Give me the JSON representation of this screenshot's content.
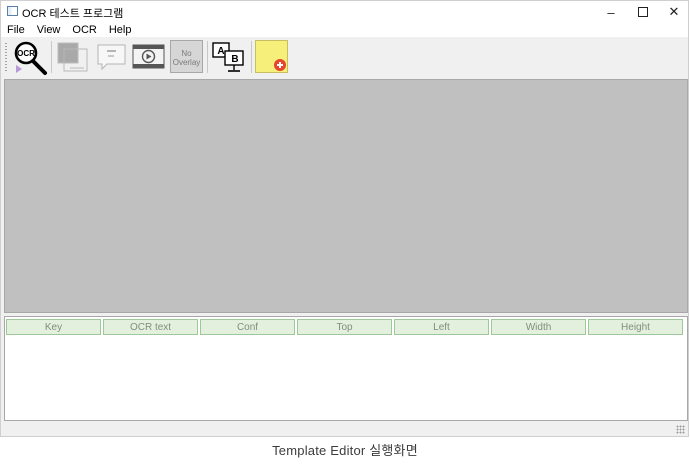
{
  "window": {
    "title": "OCR 테스트 프로그램",
    "controls": {
      "minimize": "–",
      "close": "✕"
    }
  },
  "menu": [
    "File",
    "View",
    "OCR",
    "Help"
  ],
  "toolbar": {
    "ocr_icon_text": "OCR",
    "no_overlay_line1": "No",
    "no_overlay_line2": "Overlay",
    "ab_icon_a": "A",
    "ab_icon_b": "B"
  },
  "grid": {
    "columns": [
      "Key",
      "OCR text",
      "Conf",
      "Top",
      "Left",
      "Width",
      "Height"
    ]
  },
  "caption": "Template Editor 실행화면"
}
